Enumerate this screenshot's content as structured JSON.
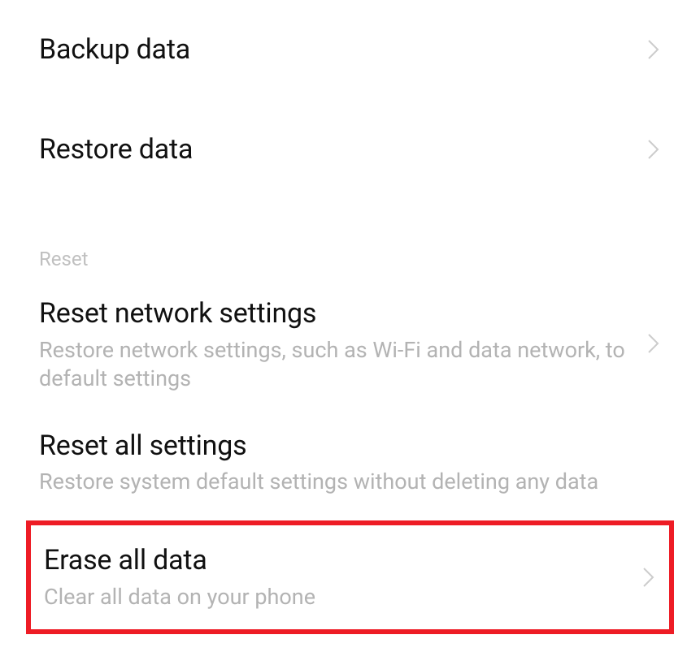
{
  "items": {
    "backup": {
      "title": "Backup data"
    },
    "restore": {
      "title": "Restore data"
    },
    "reset_network": {
      "title": "Reset network settings",
      "subtitle": "Restore network settings, such as Wi-Fi and data network, to default settings"
    },
    "reset_all": {
      "title": "Reset all settings",
      "subtitle": "Restore system default settings without deleting any data"
    },
    "erase_all": {
      "title": "Erase all data",
      "subtitle": "Clear all data on your phone"
    }
  },
  "section": {
    "reset_header": "Reset"
  }
}
